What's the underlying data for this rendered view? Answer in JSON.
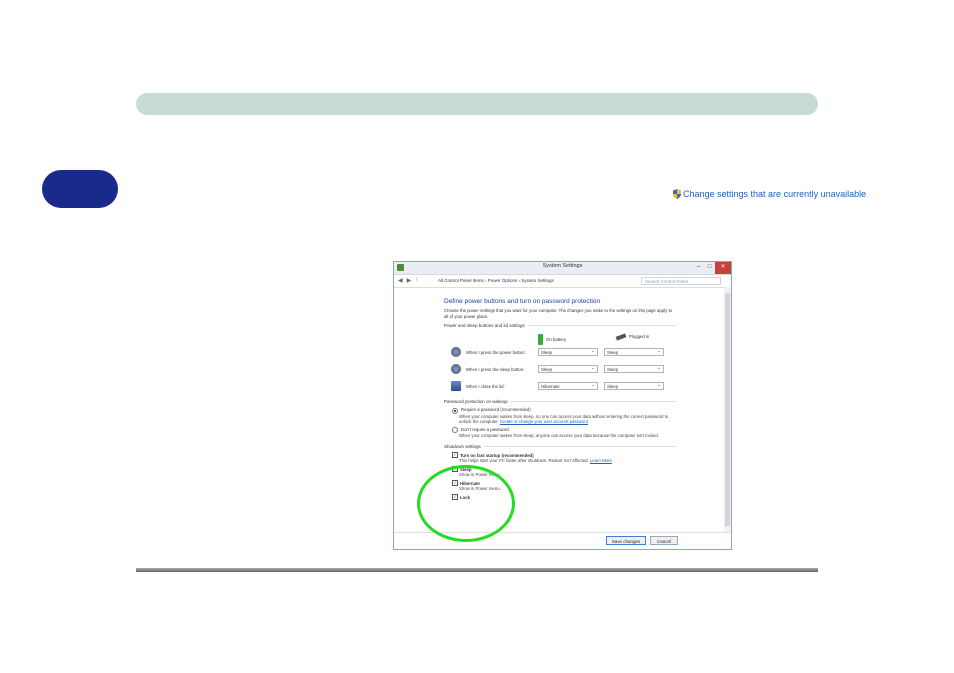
{
  "page": {
    "change_link": "Change settings that are currently unavailable"
  },
  "dialog": {
    "title": "System Settings",
    "window_buttons": {
      "minimize": "–",
      "maximize": "□",
      "close": "✕"
    },
    "address": {
      "path": "All Control Panel Items  ›  Power Options  ›  System Settings",
      "search_placeholder": "Search Control Panel"
    },
    "heading": "Define power buttons and turn on password protection",
    "description": "Choose the power settings that you want for your computer. The changes you make to the settings on this page apply to all of your power plans.",
    "power_section": {
      "title": "Power and sleep buttons and lid settings",
      "col_battery": "On battery",
      "col_plugged": "Plugged in",
      "rows": [
        {
          "label": "When I press the power button:",
          "battery": "Sleep",
          "plugged": "Sleep"
        },
        {
          "label": "When I press the sleep button:",
          "battery": "Sleep",
          "plugged": "Sleep"
        },
        {
          "label": "When I close the lid:",
          "battery": "Hibernate",
          "plugged": "Sleep"
        }
      ]
    },
    "password_section": {
      "title": "Password protection on wakeup",
      "require_label": "Require a password (recommended)",
      "require_desc": "When your computer wakes from sleep, no one can access your data without entering the correct password to unlock the computer.",
      "require_link": "Create or change your user account password",
      "norequire_label": "Don't require a password",
      "norequire_desc": "When your computer wakes from sleep, anyone can access your data because the computer isn't locked."
    },
    "shutdown_section": {
      "title": "Shutdown settings",
      "fast_startup_label": "Turn on fast startup (recommended)",
      "fast_startup_desc": "This helps start your PC faster after shutdown. Restart isn't affected.",
      "learn_more": "Learn More",
      "sleep_label": "Sleep",
      "sleep_desc": "Show in Power menu.",
      "hibernate_label": "Hibernate",
      "hibernate_desc": "Show in Power menu.",
      "lock_label": "Lock"
    },
    "save_button": "Save changes",
    "cancel_button": "Cancel",
    "check_mark": "✓"
  },
  "colors": {
    "header_bar": "#c8dcd6",
    "chapter_tab": "#1a2a8a",
    "highlight": "#22dd22",
    "link": "#1f5fbf"
  }
}
